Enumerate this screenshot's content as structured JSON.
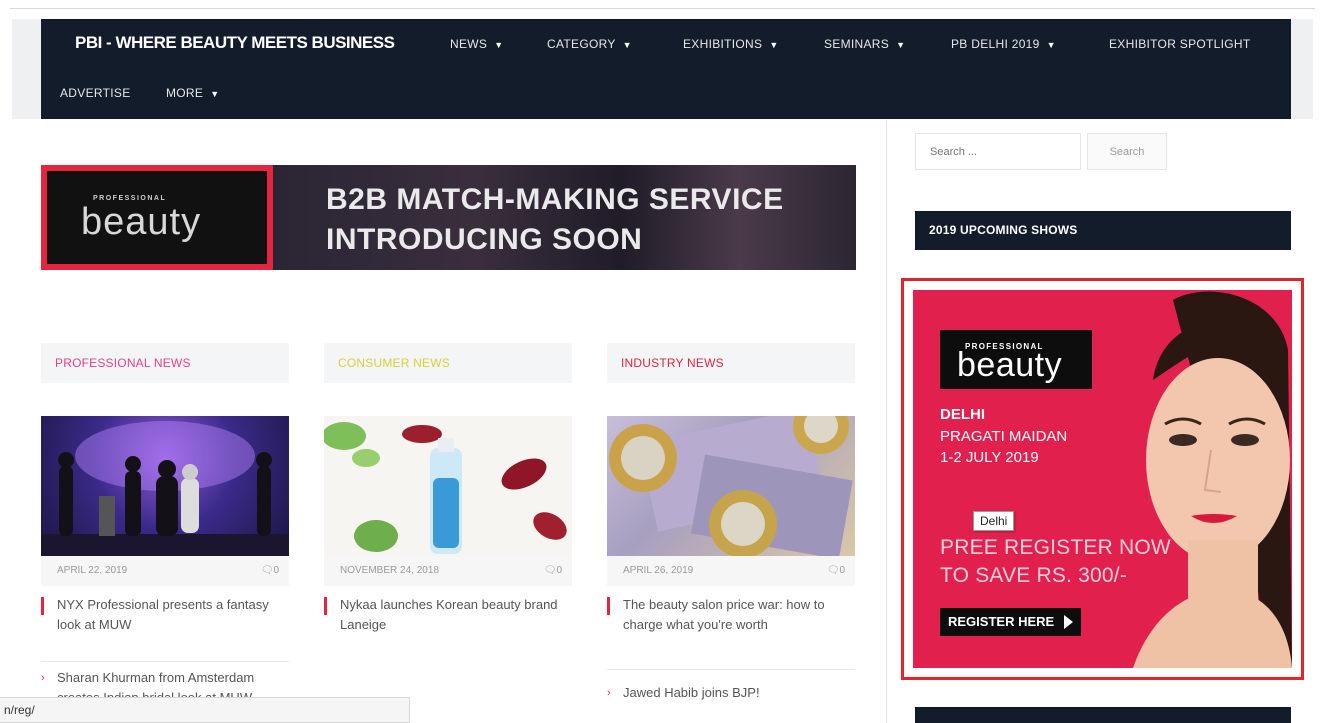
{
  "nav": {
    "brand": "PBI - WHERE BEAUTY MEETS BUSINESS",
    "items": [
      {
        "label": "NEWS",
        "caret": "▼"
      },
      {
        "label": "CATEGORY",
        "caret": "▼"
      },
      {
        "label": "EXHIBITIONS",
        "caret": "▼"
      },
      {
        "label": "SEMINARS",
        "caret": "▼"
      },
      {
        "label": "PB DELHI 2019",
        "caret": "▼"
      },
      {
        "label": "EXHIBITOR SPOTLIGHT",
        "caret": ""
      },
      {
        "label": "ADVERTISE",
        "caret": ""
      },
      {
        "label": "MORE",
        "caret": "▼"
      }
    ]
  },
  "banner": {
    "logo_pro": "PROFESSIONAL",
    "logo_beauty": "beauty",
    "line1": "B2B MATCH-MAKING SERVICE",
    "line2": "INTRODUCING SOON"
  },
  "columns": [
    {
      "heading": "PROFESSIONAL NEWS",
      "heading_color": "#e8418a",
      "date": "APRIL 22, 2019",
      "comments": "0",
      "story": "NYX Professional presents a fantasy look at MUW",
      "sub": [
        {
          "text": "Sharan Khurman from Amsterdam creates Indian bridal look at MUW"
        }
      ]
    },
    {
      "heading": "CONSUMER NEWS",
      "heading_color": "#d7d03a",
      "date": "NOVEMBER 24, 2018",
      "comments": "0",
      "story": "Nykaa launches Korean beauty brand Laneige",
      "sub": []
    },
    {
      "heading": "INDUSTRY NEWS",
      "heading_color": "#e4253f",
      "date": "APRIL 26, 2019",
      "comments": "0",
      "story": "The beauty salon price war: how to charge what you're worth",
      "sub": [
        {
          "text": "Jawed Habib joins BJP!"
        }
      ]
    }
  ],
  "sidebar": {
    "search_placeholder": "Search ...",
    "search_button": "Search",
    "widget_title": "2019 UPCOMING SHOWS",
    "ad": {
      "logo_pro": "PROFESSIONAL",
      "logo_beauty": "beauty",
      "city": "DELHI",
      "venue": "PRAGATI MAIDAN",
      "dates": "1-2 JULY 2019",
      "cta_line1": "PREE REGISTER NOW",
      "cta_line2": "TO SAVE RS. 300/-",
      "register": "REGISTER HERE"
    }
  },
  "tooltip": "Delhi",
  "status_url": "n/reg/",
  "colors": {
    "nav_bg": "#121c2b",
    "accent_red": "#e4253f",
    "ad_pink": "#e2204e",
    "highlight_outline": "#e0252d"
  },
  "icons": {
    "comment": "comment-icon",
    "caret": "chevron-down-icon",
    "arrow": "chevron-right-icon",
    "play": "play-icon"
  }
}
